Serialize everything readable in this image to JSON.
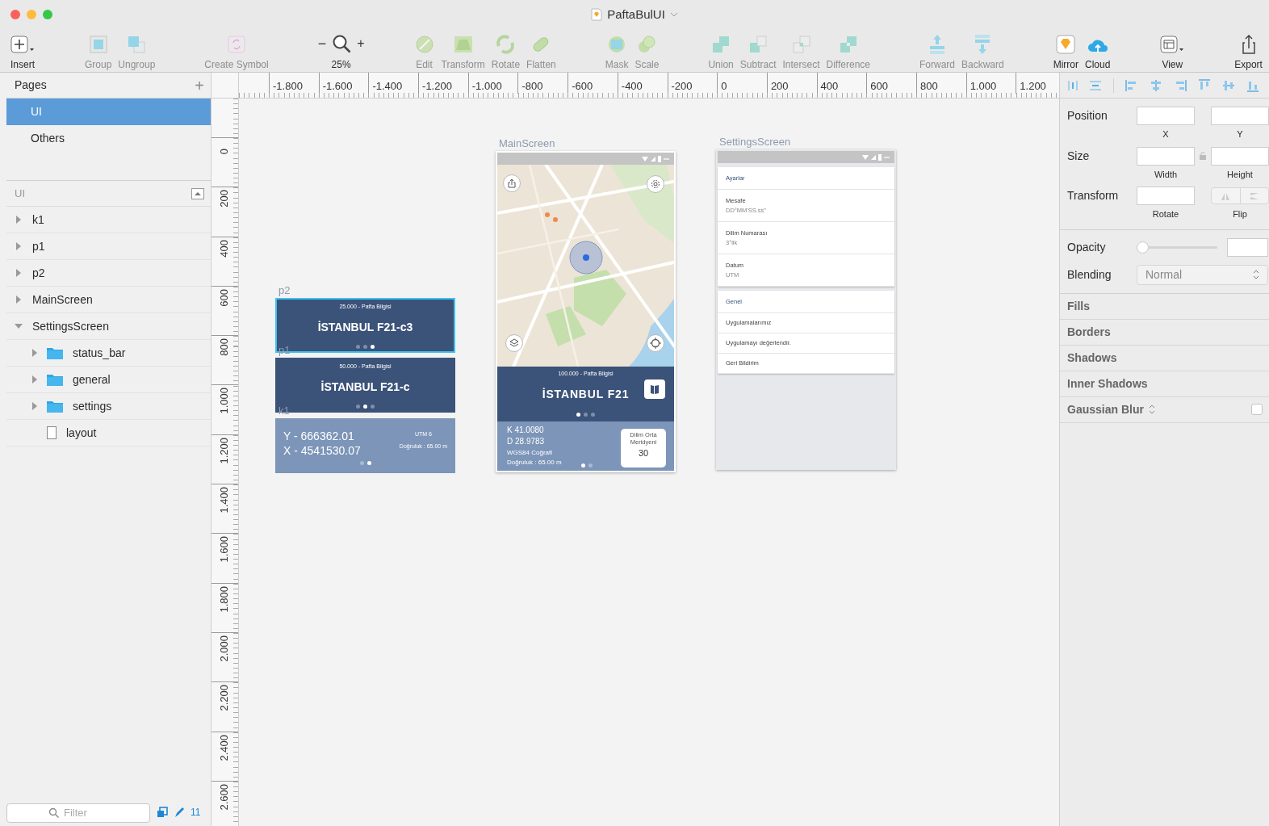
{
  "window": {
    "title": "PaftaBulUI"
  },
  "toolbar": {
    "groups": [
      [
        {
          "kind": "button",
          "label": "Insert",
          "disabled": false
        }
      ],
      [
        {
          "kind": "button",
          "label": "Group",
          "disabled": true
        },
        {
          "kind": "button",
          "label": "Ungroup",
          "disabled": true
        }
      ],
      [
        {
          "kind": "button",
          "label": "Create Symbol",
          "disabled": true
        }
      ],
      [
        {
          "kind": "zoom",
          "minus": "−",
          "plus": "+",
          "label": "25%"
        }
      ],
      [
        {
          "kind": "button",
          "label": "Edit",
          "disabled": true
        },
        {
          "kind": "button",
          "label": "Transform",
          "disabled": true
        },
        {
          "kind": "button",
          "label": "Rotate",
          "disabled": true
        },
        {
          "kind": "button",
          "label": "Flatten",
          "disabled": true
        }
      ],
      [
        {
          "kind": "button",
          "label": "Mask",
          "disabled": true
        },
        {
          "kind": "button",
          "label": "Scale",
          "disabled": true
        }
      ],
      [
        {
          "kind": "button",
          "label": "Union",
          "disabled": true
        },
        {
          "kind": "button",
          "label": "Subtract",
          "disabled": true
        },
        {
          "kind": "button",
          "label": "Intersect",
          "disabled": true
        },
        {
          "kind": "button",
          "label": "Difference",
          "disabled": true
        }
      ],
      [
        {
          "kind": "button",
          "label": "Forward",
          "disabled": true
        },
        {
          "kind": "button",
          "label": "Backward",
          "disabled": true
        }
      ],
      [
        {
          "kind": "button",
          "label": "Mirror",
          "disabled": false
        },
        {
          "kind": "button",
          "label": "Cloud",
          "disabled": false
        }
      ],
      [
        {
          "kind": "button",
          "label": "View",
          "disabled": false
        }
      ],
      [
        {
          "kind": "button",
          "label": "Export",
          "disabled": false
        }
      ]
    ]
  },
  "pages": {
    "header": "Pages",
    "add": "+",
    "items": [
      {
        "name": "UI",
        "selected": true
      },
      {
        "name": "Others",
        "selected": false
      }
    ]
  },
  "layers": {
    "header": "UI",
    "items": [
      {
        "name": "k1",
        "kind": "artboard",
        "expanded": false
      },
      {
        "name": "p1",
        "kind": "artboard",
        "expanded": false
      },
      {
        "name": "p2",
        "kind": "artboard",
        "expanded": false
      },
      {
        "name": "MainScreen",
        "kind": "artboard",
        "expanded": false
      },
      {
        "name": "SettingsScreen",
        "kind": "artboard",
        "expanded": true,
        "children": [
          {
            "name": "status_bar",
            "kind": "group",
            "expanded": false
          },
          {
            "name": "general",
            "kind": "group",
            "expanded": false
          },
          {
            "name": "settings",
            "kind": "group",
            "expanded": false
          },
          {
            "name": "layout",
            "kind": "shape"
          }
        ]
      }
    ]
  },
  "filter": {
    "placeholder": "Filter",
    "count": "11"
  },
  "rulers": {
    "horizontal": [
      "-1.800",
      "-1.600",
      "-1.400",
      "-1.200",
      "-1.000",
      "-800",
      "-600",
      "-400",
      "-200",
      "0",
      "200",
      "400",
      "600",
      "800",
      "1.000",
      "1.200"
    ],
    "vertical": [
      "0",
      "200",
      "400",
      "600",
      "800",
      "1.000",
      "1.200",
      "1.400",
      "1.600",
      "1.800",
      "2.000",
      "2.200",
      "2.400",
      "2.600"
    ]
  },
  "canvas": {
    "artboards": [
      {
        "kind": "pafta",
        "name": "p2",
        "selected": true,
        "scale": "25.000 - Pafta Bilgisi",
        "title": "İSTANBUL F21-c3",
        "pages": [
          {
            "selected": false
          },
          {
            "selected": false
          },
          {
            "selected": true
          }
        ]
      },
      {
        "kind": "pafta",
        "name": "p1",
        "selected": false,
        "scale": "50.000 - Pafta Bilgisi",
        "title": "İSTANBUL F21-c",
        "pages": [
          {
            "selected": false
          },
          {
            "selected": true
          },
          {
            "selected": false
          }
        ]
      },
      {
        "kind": "coords",
        "name": "k1",
        "selected": false,
        "lines": [
          "Y - 666362.01",
          "X - 4541530.07"
        ],
        "zone": "UTM 6",
        "accuracy": "Doğruluk : 65.00 m",
        "pages": [
          {
            "selected": false
          },
          {
            "selected": true
          }
        ]
      },
      {
        "kind": "main",
        "name": "MainScreen",
        "selected": false,
        "map": {
          "kind": "picture"
        },
        "scale": "100.000 - Pafta Bilgisi",
        "title": "İSTANBUL F21",
        "pages": [
          {
            "selected": true
          },
          {
            "selected": false
          },
          {
            "selected": false
          }
        ],
        "coords": [
          "K 41.0080",
          "D 28.9783"
        ],
        "datum": "WGS84 Coğrafi",
        "accuracy": "Doğruluk : 65.00 m",
        "meridian_label": "Dilim Orta Meridyeni",
        "meridian": "30",
        "info_pages": [
          {
            "selected": true
          },
          {
            "selected": false
          }
        ]
      },
      {
        "kind": "settings",
        "name": "SettingsScreen",
        "selected": false,
        "sections": [
          {
            "header": "Ayarlar",
            "items": [
              {
                "title": "Mesafe",
                "value": "DD°MM'SS.ss\""
              },
              {
                "title": "Dilim Numarası",
                "value": "3°lik"
              },
              {
                "title": "Datum",
                "value": "UTM"
              }
            ]
          },
          {
            "header": "Genel",
            "items": [
              {
                "title": "Uygulamalarımız"
              },
              {
                "title": "Uygulamayı değerlendir."
              },
              {
                "title": "Geri Bildirim"
              }
            ]
          }
        ]
      }
    ]
  },
  "inspector": {
    "position": {
      "label": "Position",
      "captions": [
        "X",
        "Y"
      ]
    },
    "size": {
      "label": "Size",
      "captions": [
        "Width",
        "Height"
      ]
    },
    "transform": {
      "label": "Transform",
      "captions": [
        "Rotate",
        "Flip"
      ]
    },
    "opacity": {
      "label": "Opacity",
      "level": 0
    },
    "blending": {
      "label": "Blending",
      "value": "Normal"
    },
    "sections": [
      "Fills",
      "Borders",
      "Shadows",
      "Inner Shadows"
    ],
    "blur": {
      "label": "Gaussian Blur",
      "checked": false
    }
  }
}
